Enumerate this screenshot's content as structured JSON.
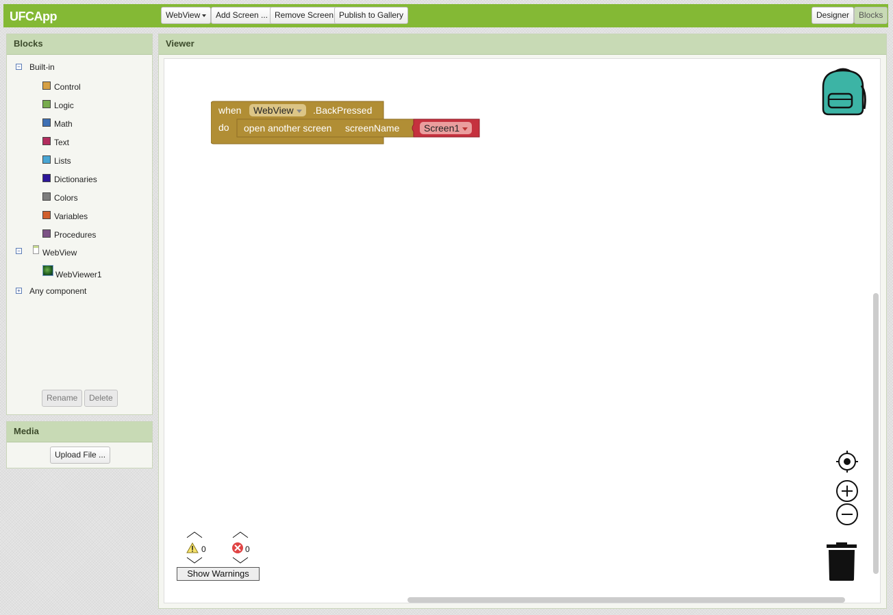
{
  "app": {
    "title": "UFCApp"
  },
  "toolbar": {
    "screen_select": "WebView",
    "add_screen": "Add Screen ...",
    "remove_screen": "Remove Screen",
    "publish": "Publish to Gallery",
    "designer": "Designer",
    "blocks": "Blocks"
  },
  "blocks_panel": {
    "title": "Blocks",
    "builtin_label": "Built-in",
    "builtin_items": [
      {
        "label": "Control",
        "color": "#d6a043"
      },
      {
        "label": "Logic",
        "color": "#77ab4d"
      },
      {
        "label": "Math",
        "color": "#3f71b5"
      },
      {
        "label": "Text",
        "color": "#b32d5e"
      },
      {
        "label": "Lists",
        "color": "#49a6d4"
      },
      {
        "label": "Dictionaries",
        "color": "#2d1799"
      },
      {
        "label": "Colors",
        "color": "#7d7d7d"
      },
      {
        "label": "Variables",
        "color": "#d05f2d"
      },
      {
        "label": "Procedures",
        "color": "#7c5385"
      }
    ],
    "screen_label": "WebView",
    "component_label": "WebViewer1",
    "any_component_label": "Any component",
    "rename": "Rename",
    "delete": "Delete"
  },
  "media_panel": {
    "title": "Media",
    "upload": "Upload File ..."
  },
  "viewer": {
    "title": "Viewer",
    "event_block": {
      "when": "when",
      "component": "WebView",
      "event": ".BackPressed",
      "do": "do",
      "action": "open another screen",
      "param": "screenName",
      "screen_value": "Screen1",
      "color": "#b18e35",
      "value_color": "#c5313e"
    },
    "warnings_count": "0",
    "errors_count": "0",
    "show_warnings": "Show Warnings"
  }
}
